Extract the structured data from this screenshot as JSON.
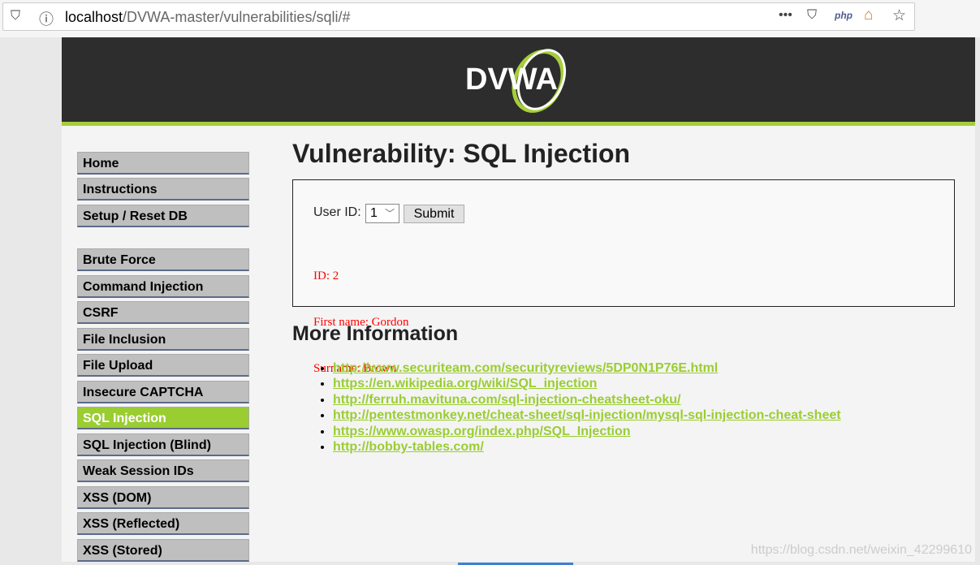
{
  "browser": {
    "url_host": "localhost",
    "url_path": "/DVWA-master/vulnerabilities/sqli/#",
    "icons": [
      "shield-icon",
      "info-icon",
      "more-icon",
      "pocket-icon",
      "php-icon",
      "home-icon",
      "star-icon"
    ],
    "php_label": "php"
  },
  "header": {
    "logo_text": "DVWA",
    "accent": "#a6ce39"
  },
  "menu": {
    "group1": [
      "Home",
      "Instructions",
      "Setup / Reset DB"
    ],
    "group2": [
      "Brute Force",
      "Command Injection",
      "CSRF",
      "File Inclusion",
      "File Upload",
      "Insecure CAPTCHA",
      "SQL Injection",
      "SQL Injection (Blind)",
      "Weak Session IDs",
      "XSS (DOM)",
      "XSS (Reflected)",
      "XSS (Stored)"
    ],
    "selected": "SQL Injection"
  },
  "main": {
    "title": "Vulnerability: SQL Injection",
    "user_id_label": "User ID:",
    "user_id_value": "1",
    "submit_label": "Submit",
    "result": [
      "ID: 2",
      "First name: Gordon",
      "Surname: Brown"
    ],
    "more_title": "More Information",
    "links": [
      "http://www.securiteam.com/securityreviews/5DP0N1P76E.html",
      "https://en.wikipedia.org/wiki/SQL_injection",
      "http://ferruh.mavituna.com/sql-injection-cheatsheet-oku/",
      "http://pentestmonkey.net/cheat-sheet/sql-injection/mysql-sql-injection-cheat-sheet",
      "https://www.owasp.org/index.php/SQL_Injection",
      "http://bobby-tables.com/"
    ]
  },
  "watermark": "https://blog.csdn.net/weixin_42299610"
}
